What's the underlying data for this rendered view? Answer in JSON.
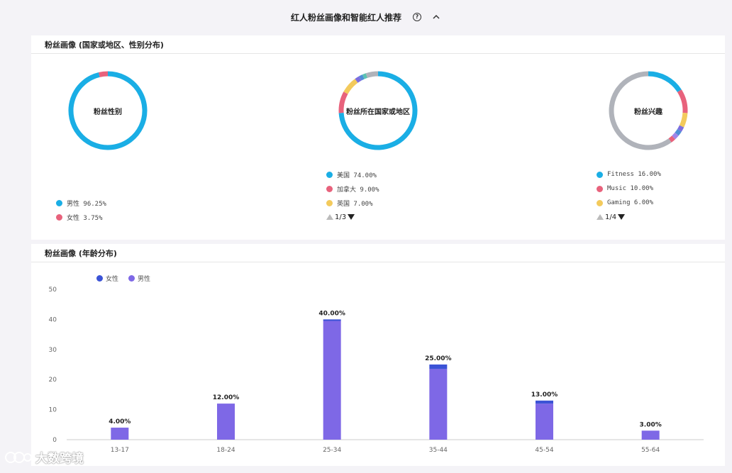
{
  "header": {
    "title": "红人粉丝画像和智能红人推荐",
    "help_glyph": "?"
  },
  "profile_panel": {
    "title": "粉丝画像 (国家或地区、性别分布)",
    "gender": {
      "center_label": "粉丝性别",
      "legend": [
        {
          "label": "男性 96.25%",
          "color": "#1aaee5"
        },
        {
          "label": "女性 3.75%",
          "color": "#e8627c"
        }
      ],
      "values": [
        96.25,
        3.75
      ]
    },
    "country": {
      "center_label": "粉丝所在国家或地区",
      "legend": [
        {
          "label": "美国 74.00%",
          "color": "#1aaee5"
        },
        {
          "label": "加拿大 9.00%",
          "color": "#e8627c"
        },
        {
          "label": "英国 7.00%",
          "color": "#f3ca5c"
        }
      ],
      "pager": "1/3",
      "values": [
        74,
        9,
        7,
        2,
        1.5,
        1.5,
        5
      ],
      "colors": [
        "#1aaee5",
        "#e8627c",
        "#f3ca5c",
        "#7c6ee0",
        "#4f8fd6",
        "#5cc3b0",
        "#b0b3ba"
      ]
    },
    "interest": {
      "center_label": "粉丝兴趣",
      "legend": [
        {
          "label": "Fitness 16.00%",
          "color": "#1aaee5"
        },
        {
          "label": "Music 10.00%",
          "color": "#e8627c"
        },
        {
          "label": "Gaming 6.00%",
          "color": "#f3ca5c"
        }
      ],
      "pager": "1/4",
      "values": [
        16,
        10,
        6,
        2,
        2,
        2,
        2,
        60
      ],
      "colors": [
        "#1aaee5",
        "#e8627c",
        "#f3ca5c",
        "#7c6ee0",
        "#4f8fd6",
        "#9f86e8",
        "#e8627c",
        "#b0b3ba"
      ]
    }
  },
  "age_panel": {
    "title": "粉丝画像 (年龄分布)",
    "legend": [
      {
        "label": "女性",
        "color": "#3b53d6"
      },
      {
        "label": "男性",
        "color": "#7e68e6"
      }
    ]
  },
  "chart_data": {
    "type": "bar",
    "categories": [
      "13-17",
      "18-24",
      "25-34",
      "35-44",
      "45-54",
      "55-64"
    ],
    "series": [
      {
        "name": "男性",
        "values": [
          4.0,
          12.0,
          39.5,
          23.5,
          12.0,
          3.0
        ],
        "color": "#7e68e6"
      },
      {
        "name": "女性",
        "values": [
          0.0,
          0.0,
          0.5,
          1.5,
          1.0,
          0.0
        ],
        "color": "#3b53d6"
      }
    ],
    "totals": [
      "4.00%",
      "12.00%",
      "40.00%",
      "25.00%",
      "13.00%",
      "3.00%"
    ],
    "yticks": [
      0,
      10,
      20,
      30,
      40,
      50
    ],
    "ylim": [
      0,
      50
    ],
    "stacked": true,
    "grid": false,
    "legend_position": "top-left"
  },
  "watermark": {
    "text": "大数跨境"
  }
}
